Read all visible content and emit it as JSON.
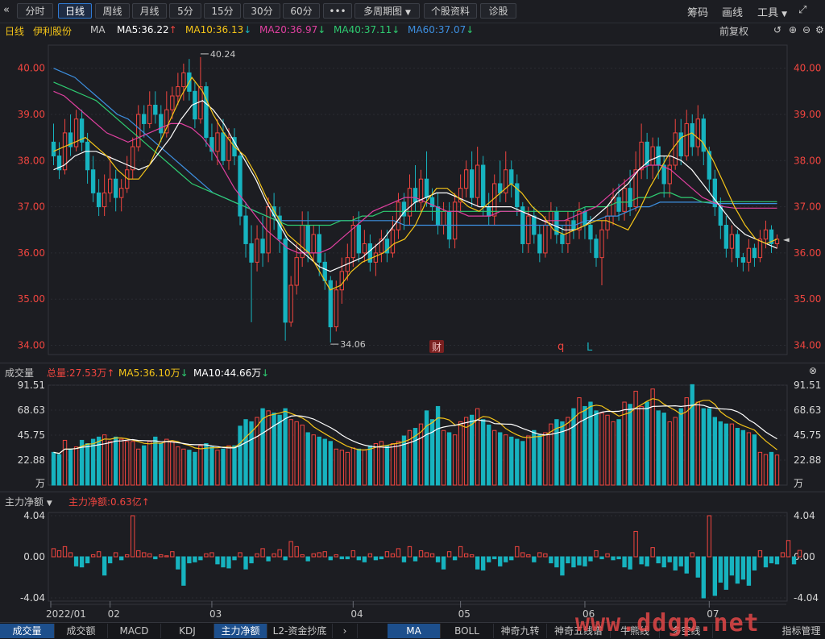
{
  "toolbar": {
    "periods": [
      "分时",
      "日线",
      "周线",
      "月线",
      "5分",
      "15分",
      "30分",
      "60分"
    ],
    "active_period": "日线",
    "more_label": "•••",
    "multi_period_label": "多周期图",
    "profile_label": "个股资料",
    "diagnose_label": "诊股",
    "chips_label": "筹码",
    "draw_label": "画线",
    "tools_label": "工具"
  },
  "ma_header": {
    "period": "日线",
    "stock_name": "伊利股份",
    "indicator": "MA",
    "ma5": "MA5:36.22",
    "ma10": "MA10:36.13",
    "ma20": "MA20:36.97",
    "ma40": "MA40:37.11",
    "ma60": "MA60:37.07",
    "adjust_label": "前复权"
  },
  "price_axis_labels": [
    "40.00",
    "39.00",
    "38.00",
    "37.00",
    "36.00",
    "35.00",
    "34.00"
  ],
  "annotations": {
    "high": "40.24",
    "low": "34.06",
    "fin_badge": "财",
    "q_mark": "q",
    "l_mark": "L"
  },
  "volume_header": {
    "label": "成交量",
    "total": "总量:27.53万",
    "ma5": "MA5:36.10万",
    "ma10": "MA10:44.66万"
  },
  "volume_axis_labels": [
    "91.51",
    "68.63",
    "45.75",
    "22.88",
    "万"
  ],
  "flow_header": {
    "label": "主力净额",
    "value": "主力净额:0.63亿"
  },
  "flow_axis_labels": [
    "4.04",
    "0.00",
    "-4.04"
  ],
  "date_labels": [
    "2022/01",
    "02",
    "03",
    "04",
    "05",
    "06",
    "07"
  ],
  "bottom_tabs_left": [
    "成交量",
    "成交额",
    "MACD",
    "KDJ",
    "主力净额",
    "L2-资金抄底"
  ],
  "bottom_tabs_right": [
    "MA",
    "BOLL",
    "神奇九转",
    "神奇五线谱",
    "牛熊线",
    "多空线",
    "指标管理"
  ],
  "watermark": "www.ddgp.net",
  "colors": {
    "up": "#f0453f",
    "down": "#17b3bf",
    "ma5": "#f5c518",
    "ma10": "#ffffff",
    "ma20": "#e040a0",
    "ma40": "#2ecc71",
    "ma60": "#3d8fe0"
  },
  "chart_data": {
    "type": "candlestick",
    "price_range": [
      33.8,
      40.5
    ],
    "volume_range": [
      0,
      91.51
    ],
    "flow_range": [
      -4.04,
      4.04
    ],
    "candles": [
      [
        38.4,
        38.1,
        38.8,
        37.9
      ],
      [
        38.1,
        37.8,
        38.4,
        37.6
      ],
      [
        37.8,
        38.6,
        38.9,
        37.7
      ],
      [
        38.6,
        38.3,
        39.0,
        38.1
      ],
      [
        38.3,
        38.9,
        39.1,
        38.2
      ],
      [
        38.9,
        38.4,
        39.1,
        38.2
      ],
      [
        38.4,
        37.8,
        38.6,
        37.5
      ],
      [
        37.8,
        37.3,
        38.1,
        37.1
      ],
      [
        37.3,
        37.0,
        37.6,
        36.8
      ],
      [
        37.0,
        37.3,
        37.7,
        36.8
      ],
      [
        37.3,
        37.6,
        38.1,
        37.1
      ],
      [
        37.6,
        37.2,
        37.8,
        36.9
      ],
      [
        37.2,
        37.4,
        37.6,
        36.9
      ],
      [
        37.4,
        37.8,
        38.1,
        37.3
      ],
      [
        37.8,
        38.3,
        38.5,
        37.6
      ],
      [
        38.3,
        39.0,
        39.2,
        38.2
      ],
      [
        39.0,
        38.8,
        39.2,
        38.5
      ],
      [
        38.8,
        39.2,
        39.5,
        38.7
      ],
      [
        39.2,
        39.0,
        39.5,
        38.8
      ],
      [
        39.0,
        38.6,
        39.2,
        38.4
      ],
      [
        38.6,
        39.1,
        39.5,
        38.5
      ],
      [
        39.1,
        39.4,
        39.6,
        38.9
      ],
      [
        39.4,
        39.6,
        39.9,
        39.2
      ],
      [
        39.6,
        39.9,
        40.1,
        39.3
      ],
      [
        39.9,
        39.5,
        40.2,
        39.3
      ],
      [
        39.5,
        38.9,
        39.7,
        38.7
      ],
      [
        38.9,
        39.6,
        40.24,
        38.8
      ],
      [
        39.6,
        38.5,
        39.7,
        38.3
      ],
      [
        38.5,
        38.2,
        38.8,
        38.0
      ],
      [
        38.2,
        38.6,
        38.9,
        37.9
      ],
      [
        38.6,
        38.0,
        38.9,
        37.9
      ],
      [
        38.0,
        38.5,
        38.7,
        37.8
      ],
      [
        38.5,
        38.1,
        38.7,
        37.9
      ],
      [
        38.1,
        36.8,
        38.2,
        36.6
      ],
      [
        36.8,
        36.2,
        37.1,
        35.9
      ],
      [
        36.2,
        35.8,
        36.6,
        34.5
      ],
      [
        35.8,
        36.3,
        36.6,
        35.6
      ],
      [
        36.3,
        36.0,
        36.8,
        35.7
      ],
      [
        36.0,
        37.0,
        37.2,
        35.8
      ],
      [
        37.0,
        36.8,
        37.3,
        36.5
      ],
      [
        36.8,
        36.3,
        37.0,
        36.0
      ],
      [
        36.3,
        34.5,
        36.4,
        34.1
      ],
      [
        34.5,
        35.3,
        35.5,
        34.4
      ],
      [
        35.3,
        35.9,
        36.2,
        35.1
      ],
      [
        35.9,
        36.6,
        36.9,
        35.7
      ],
      [
        36.6,
        36.0,
        36.9,
        35.8
      ],
      [
        36.0,
        36.4,
        36.6,
        35.8
      ],
      [
        36.4,
        35.8,
        36.6,
        35.5
      ],
      [
        35.8,
        35.4,
        36.0,
        35.2
      ],
      [
        35.4,
        34.4,
        35.5,
        34.06
      ],
      [
        34.4,
        35.2,
        35.4,
        34.3
      ],
      [
        35.2,
        35.6,
        35.9,
        34.9
      ],
      [
        35.6,
        35.9,
        36.2,
        35.4
      ],
      [
        35.9,
        36.6,
        36.8,
        35.7
      ],
      [
        36.6,
        36.0,
        36.9,
        35.8
      ],
      [
        36.0,
        36.2,
        36.5,
        35.8
      ],
      [
        36.2,
        35.8,
        36.4,
        35.6
      ],
      [
        35.8,
        36.0,
        36.2,
        35.5
      ],
      [
        36.0,
        36.3,
        36.5,
        35.8
      ],
      [
        36.3,
        36.0,
        36.5,
        35.8
      ],
      [
        36.0,
        36.5,
        36.8,
        35.9
      ],
      [
        36.5,
        37.1,
        37.3,
        36.3
      ],
      [
        37.1,
        36.8,
        37.3,
        36.5
      ],
      [
        36.8,
        37.4,
        37.7,
        36.6
      ],
      [
        37.4,
        37.1,
        37.9,
        36.9
      ],
      [
        37.1,
        37.6,
        37.8,
        36.9
      ],
      [
        37.6,
        37.2,
        38.2,
        37.0
      ],
      [
        37.2,
        37.0,
        37.4,
        36.7
      ],
      [
        37.0,
        36.6,
        37.3,
        36.4
      ],
      [
        36.6,
        36.9,
        37.1,
        36.4
      ],
      [
        36.9,
        36.3,
        37.1,
        36.1
      ],
      [
        36.3,
        37.1,
        37.3,
        36.1
      ],
      [
        37.1,
        37.4,
        37.7,
        36.9
      ],
      [
        37.4,
        37.8,
        38.0,
        37.2
      ],
      [
        37.8,
        37.2,
        38.2,
        37.0
      ],
      [
        37.2,
        37.9,
        38.3,
        37.0
      ],
      [
        37.9,
        37.0,
        38.1,
        36.8
      ],
      [
        37.0,
        36.8,
        37.3,
        36.6
      ],
      [
        36.8,
        37.5,
        37.7,
        36.6
      ],
      [
        37.5,
        37.3,
        38.0,
        37.1
      ],
      [
        37.3,
        37.8,
        38.2,
        37.1
      ],
      [
        37.8,
        37.5,
        38.0,
        37.2
      ],
      [
        37.5,
        37.0,
        37.7,
        36.8
      ],
      [
        37.0,
        36.2,
        37.1,
        36.0
      ],
      [
        36.2,
        36.8,
        37.0,
        36.0
      ],
      [
        36.8,
        36.4,
        37.0,
        36.2
      ],
      [
        36.4,
        36.0,
        36.6,
        35.8
      ],
      [
        36.0,
        36.6,
        36.8,
        35.9
      ],
      [
        36.6,
        36.9,
        37.1,
        36.3
      ],
      [
        36.9,
        36.4,
        37.0,
        36.2
      ],
      [
        36.4,
        36.2,
        36.6,
        36.0
      ],
      [
        36.2,
        36.7,
        36.9,
        36.0
      ],
      [
        36.7,
        36.5,
        36.9,
        36.3
      ],
      [
        36.5,
        36.9,
        37.1,
        36.3
      ],
      [
        36.9,
        36.6,
        37.0,
        36.3
      ],
      [
        36.6,
        36.3,
        36.8,
        36.0
      ],
      [
        36.3,
        35.9,
        36.4,
        35.7
      ],
      [
        35.9,
        36.5,
        36.7,
        35.3
      ],
      [
        36.5,
        36.8,
        37.0,
        36.3
      ],
      [
        36.8,
        37.2,
        37.4,
        36.6
      ],
      [
        37.2,
        36.9,
        37.5,
        36.7
      ],
      [
        36.9,
        37.4,
        37.6,
        36.7
      ],
      [
        37.4,
        37.0,
        37.8,
        36.8
      ],
      [
        37.0,
        37.8,
        38.2,
        36.9
      ],
      [
        37.8,
        38.4,
        38.8,
        37.6
      ],
      [
        38.4,
        37.9,
        38.6,
        37.6
      ],
      [
        37.9,
        38.3,
        38.5,
        37.6
      ],
      [
        38.3,
        37.9,
        38.5,
        37.6
      ],
      [
        37.9,
        37.5,
        38.1,
        37.2
      ],
      [
        37.5,
        37.9,
        38.1,
        37.2
      ],
      [
        37.9,
        38.6,
        38.9,
        37.8
      ],
      [
        38.6,
        38.1,
        38.9,
        37.9
      ],
      [
        38.1,
        38.8,
        39.1,
        38.0
      ],
      [
        38.8,
        38.3,
        39.0,
        38.1
      ],
      [
        38.3,
        38.9,
        39.2,
        38.1
      ],
      [
        38.9,
        38.2,
        39.0,
        37.9
      ],
      [
        38.2,
        37.6,
        38.3,
        37.3
      ],
      [
        37.6,
        37.0,
        37.8,
        36.8
      ],
      [
        37.0,
        36.6,
        37.2,
        36.3
      ],
      [
        36.6,
        36.1,
        36.8,
        35.9
      ],
      [
        36.1,
        36.4,
        36.6,
        35.8
      ],
      [
        36.4,
        35.9,
        36.5,
        35.7
      ],
      [
        35.9,
        35.8,
        36.0,
        35.6
      ],
      [
        35.8,
        36.1,
        36.3,
        35.6
      ],
      [
        36.1,
        35.9,
        36.2,
        35.7
      ],
      [
        35.9,
        36.3,
        36.5,
        35.8
      ],
      [
        36.3,
        36.5,
        36.7,
        36.1
      ],
      [
        36.5,
        36.2,
        36.6,
        36.0
      ],
      [
        36.2,
        36.3,
        36.4,
        36.1
      ]
    ],
    "ma5": [
      38.2,
      38.3,
      38.4,
      38.5,
      38.3,
      38.1,
      37.8,
      37.6,
      37.6,
      37.9,
      38.4,
      38.9,
      39.4,
      39.8,
      39.5,
      39.0,
      38.6,
      38.3,
      38.1,
      37.7,
      37.2,
      36.8,
      36.4,
      36.2,
      36.0,
      35.6,
      35.2,
      35.3,
      35.6,
      35.8,
      35.9,
      36.0,
      36.2,
      36.3,
      36.6,
      37.1,
      37.4,
      37.4,
      37.2,
      37.0,
      36.9,
      37.1,
      37.3,
      37.5,
      37.3,
      37.0,
      36.8,
      36.5,
      36.4,
      36.5,
      36.6,
      36.7,
      36.7,
      36.6,
      36.5,
      36.9,
      37.4,
      37.8,
      38.2,
      38.5,
      38.6,
      38.4,
      38.0,
      37.5,
      37.0,
      36.6,
      36.3,
      36.2,
      36.3
    ],
    "ma10": [
      37.8,
      37.9,
      38.1,
      38.2,
      38.2,
      38.1,
      38.0,
      37.9,
      37.8,
      37.9,
      38.2,
      38.5,
      38.9,
      39.2,
      39.3,
      39.1,
      38.8,
      38.4,
      38.0,
      37.6,
      37.1,
      36.7,
      36.3,
      36.1,
      35.9,
      35.7,
      35.6,
      35.7,
      35.8,
      35.9,
      36.1,
      36.3,
      36.6,
      36.9,
      37.1,
      37.2,
      37.3,
      37.3,
      37.2,
      37.1,
      37.0,
      37.0,
      37.0,
      37.0,
      36.9,
      36.8,
      36.7,
      36.6,
      36.5,
      36.5,
      36.6,
      36.8,
      37.0,
      37.3,
      37.5,
      37.8,
      38.0,
      38.1,
      38.1,
      38.0,
      37.8,
      37.5,
      37.2,
      36.9,
      36.6,
      36.4,
      36.3,
      36.2,
      36.1
    ],
    "ma20": [
      39.5,
      39.4,
      39.2,
      39.0,
      38.8,
      38.6,
      38.5,
      38.4,
      38.5,
      38.6,
      38.7,
      38.8,
      38.8,
      38.7,
      38.5,
      38.2,
      37.8,
      37.4,
      37.1,
      36.8,
      36.5,
      36.3,
      36.1,
      36.0,
      36.0,
      36.0,
      36.1,
      36.3,
      36.5,
      36.7,
      36.9,
      37.0,
      37.1,
      37.2,
      37.2,
      37.1,
      37.0,
      36.9,
      36.9,
      36.8,
      36.8,
      36.8,
      36.9,
      36.9,
      36.9,
      36.8,
      36.7,
      36.7,
      36.7,
      36.8,
      36.9,
      37.0,
      37.2,
      37.4,
      37.6,
      37.8,
      37.9,
      37.9,
      37.8,
      37.6,
      37.4,
      37.2,
      37.1,
      37.0,
      36.97,
      36.97,
      36.97,
      36.97,
      36.97
    ],
    "ma40": [
      39.7,
      39.6,
      39.5,
      39.4,
      39.3,
      39.1,
      38.9,
      38.7,
      38.5,
      38.3,
      38.1,
      37.9,
      37.7,
      37.5,
      37.4,
      37.3,
      37.2,
      37.1,
      37.0,
      36.9,
      36.8,
      36.7,
      36.6,
      36.6,
      36.6,
      36.6,
      36.6,
      36.7,
      36.7,
      36.8,
      36.8,
      36.9,
      36.9,
      36.9,
      36.9,
      36.9,
      36.9,
      36.9,
      36.9,
      36.9,
      36.9,
      36.9,
      36.9,
      36.9,
      36.9,
      36.9,
      36.9,
      36.9,
      36.9,
      36.9,
      37.0,
      37.0,
      37.0,
      37.1,
      37.1,
      37.2,
      37.2,
      37.3,
      37.3,
      37.2,
      37.2,
      37.1,
      37.1,
      37.11,
      37.11,
      37.11,
      37.11,
      37.11,
      37.11
    ],
    "ma60": [
      40.0,
      39.9,
      39.8,
      39.6,
      39.4,
      39.2,
      39.0,
      38.9,
      38.7,
      38.5,
      38.3,
      38.1,
      37.9,
      37.7,
      37.5,
      37.3,
      37.2,
      37.1,
      37.0,
      36.9,
      36.8,
      36.7,
      36.7,
      36.7,
      36.7,
      36.7,
      36.7,
      36.7,
      36.7,
      36.7,
      36.7,
      36.7,
      36.7,
      36.6,
      36.6,
      36.6,
      36.6,
      36.6,
      36.6,
      36.6,
      36.6,
      36.6,
      36.6,
      36.6,
      36.6,
      36.6,
      36.6,
      36.6,
      36.6,
      36.6,
      36.7,
      36.7,
      36.8,
      36.8,
      36.9,
      37.0,
      37.0,
      37.1,
      37.1,
      37.1,
      37.1,
      37.1,
      37.07,
      37.07,
      37.07,
      37.07,
      37.07,
      37.07,
      37.07
    ],
    "volumes": [
      30,
      28,
      41,
      33,
      35,
      41,
      38,
      42,
      44,
      46,
      40,
      44,
      42,
      40,
      40,
      33,
      36,
      40,
      44,
      38,
      42,
      40,
      35,
      33,
      32,
      30,
      36,
      38,
      35,
      32,
      33,
      36,
      36,
      54,
      60,
      58,
      62,
      70,
      68,
      66,
      64,
      70,
      60,
      58,
      55,
      48,
      46,
      44,
      42,
      40,
      33,
      32,
      30,
      34,
      33,
      32,
      36,
      38,
      40,
      36,
      38,
      40,
      45,
      50,
      52,
      56,
      68,
      60,
      72,
      50,
      48,
      46,
      58,
      62,
      64,
      70,
      60,
      55,
      50,
      48,
      46,
      44,
      42,
      40,
      45,
      50,
      46,
      48,
      56,
      60,
      58,
      62,
      70,
      80,
      72,
      76,
      68,
      66,
      64,
      58,
      60,
      76,
      74,
      86,
      72,
      76,
      88,
      68,
      66,
      58,
      62,
      70,
      80,
      92,
      76,
      70,
      70,
      62,
      58,
      56,
      56,
      52,
      50,
      48,
      46,
      30,
      28,
      30,
      27.53
    ],
    "flow": [
      0.8,
      0.6,
      1.0,
      0.4,
      -0.9,
      -1.0,
      -0.6,
      0.2,
      0.5,
      -1.8,
      -0.6,
      0.4,
      -0.3,
      0.2,
      4.5,
      0.6,
      0.4,
      0.3,
      -0.2,
      0.2,
      0.1,
      0.5,
      -1.2,
      -2.8,
      -0.6,
      -0.5,
      -0.3,
      0.3,
      0.4,
      -0.7,
      -1.0,
      -1.1,
      -0.3,
      0.4,
      -1.2,
      -0.6,
      0.3,
      0.8,
      -0.4,
      0.3,
      0.7,
      -0.3,
      1.5,
      1.0,
      0.2,
      -0.4,
      0.3,
      0.4,
      0.5,
      -0.3,
      0.2,
      -0.2,
      -0.2,
      0.6,
      -0.3,
      -0.5,
      0.3,
      -0.3,
      -0.2,
      0.5,
      0.3,
      0.8,
      -0.5,
      1.0,
      -0.4,
      0.6,
      0.4,
      0.3,
      -0.5,
      -1.2,
      0.5,
      -0.3,
      1.0,
      0.3,
      0.2,
      -1.2,
      -1.3,
      -0.5,
      -0.2,
      -0.9,
      -0.5,
      -0.3,
      1.0,
      0.4,
      0.2,
      -0.5,
      0.4,
      0.3,
      -0.6,
      -1.0,
      -1.8,
      -0.6,
      -1.0,
      -0.8,
      -0.9,
      -0.4,
      0.6,
      -0.2,
      0.3,
      -0.3,
      -0.2,
      -1.0,
      -1.2,
      2.5,
      -0.7,
      -0.9,
      0.9,
      -0.6,
      -1.0,
      -0.5,
      -1.3,
      -0.9,
      -1.6,
      0.4,
      -2.0,
      -4.3,
      4.8,
      -3.8,
      -2.5,
      -3.2,
      -1.8,
      -2.6,
      -2.2,
      -2.8,
      -1.3,
      0.6,
      -1.0,
      -0.6,
      -0.7,
      0.4,
      1.6,
      -0.7,
      0.63
    ]
  }
}
